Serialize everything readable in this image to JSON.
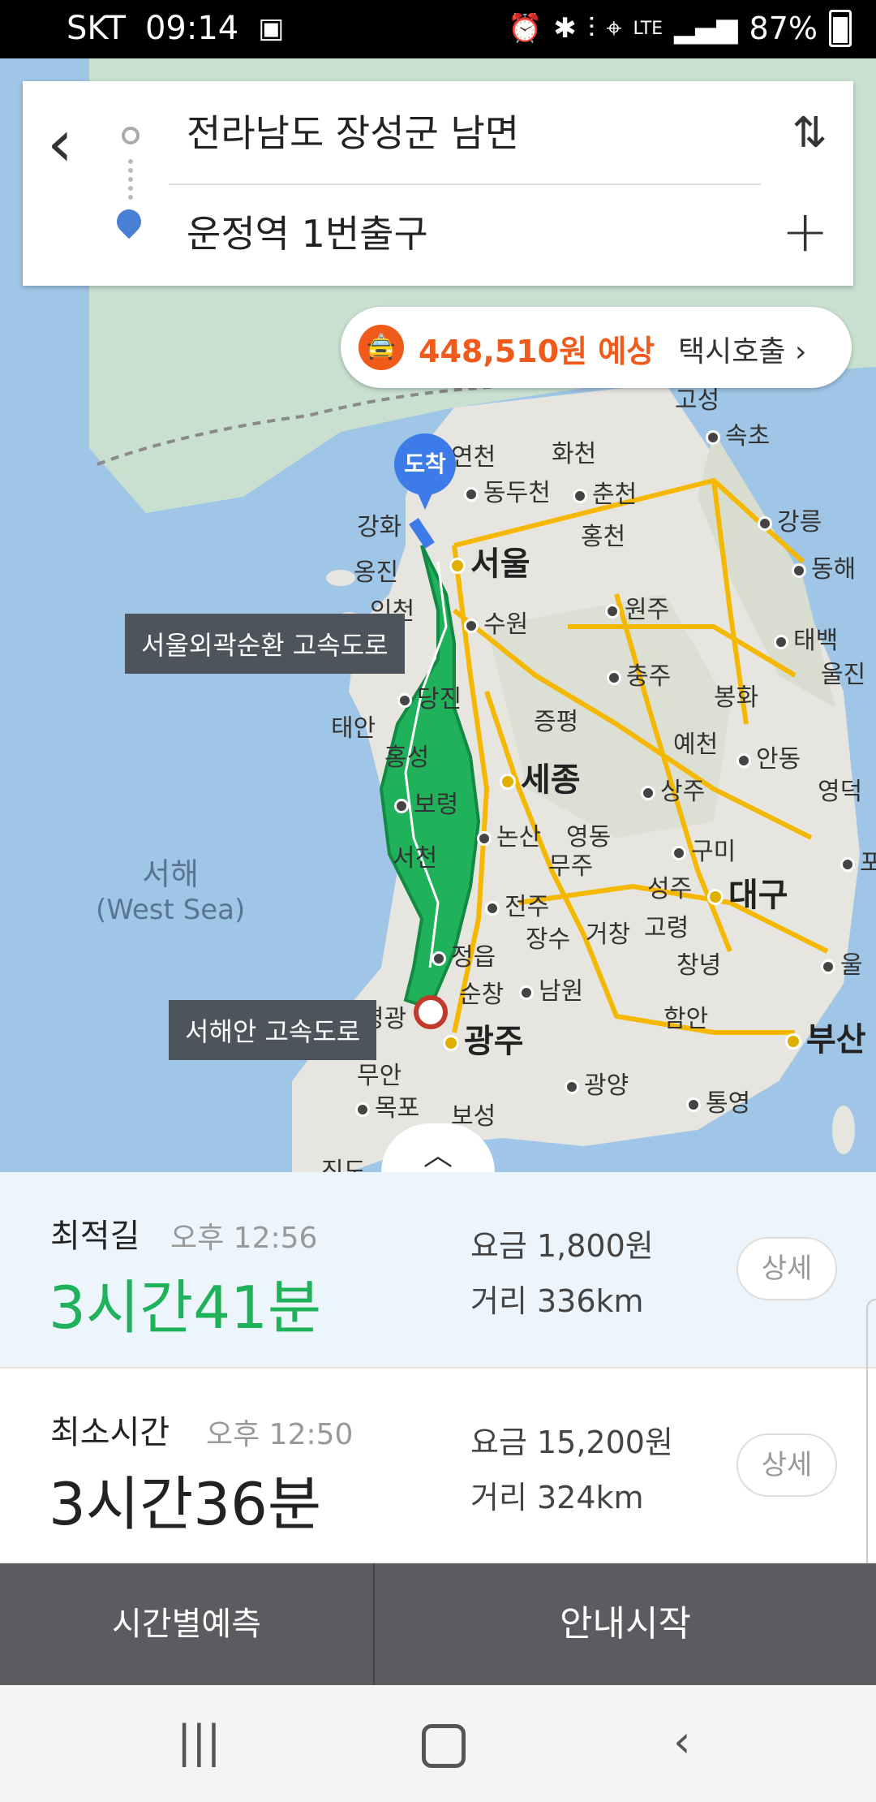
{
  "status_bar": {
    "carrier": "SKT",
    "time": "09:14",
    "network": "LTE",
    "battery": "87%"
  },
  "search": {
    "start": "전라남도 장성군 남면",
    "destination": "운정역 1번출구"
  },
  "taxi": {
    "price": "448,510원 예상",
    "call_label": "택시호출",
    "accent": "#f05a1a"
  },
  "map": {
    "arrival_pin": "도착",
    "road_labels": [
      "서울외곽순환 고속도로",
      "서해안 고속도로"
    ],
    "sea_label": "서해",
    "sea_label_en": "(West Sea)",
    "cities": {
      "goseong": "고성",
      "sokcho": "속초",
      "yeoncheon": "연천",
      "hwacheon": "화천",
      "dongducheon": "동두천",
      "chuncheon": "춘천",
      "ganghwa": "강화",
      "hongcheon": "홍천",
      "gangneung": "강릉",
      "ongjin": "옹진",
      "seoul": "서울",
      "donghae": "동해",
      "incheon": "인천",
      "suwon": "수원",
      "wonju": "원주",
      "taebaek": "태백",
      "uljin": "울진",
      "chungju": "충주",
      "dangjin": "당진",
      "bonghwa": "봉화",
      "taean": "태안",
      "jeungpyeong": "증평",
      "hongseong": "홍성",
      "yecheon": "예천",
      "andong": "안동",
      "sejong": "세종",
      "sangju": "상주",
      "yeongdeok": "영덕",
      "boryeong": "보령",
      "nonsan": "논산",
      "yeongdong": "영동",
      "seocheon": "서천",
      "muju": "무주",
      "gumi": "구미",
      "pohang": "포",
      "seongju": "성주",
      "daegu": "대구",
      "jeonju": "전주",
      "jangsu": "장수",
      "geochang": "거창",
      "goryeong": "고령",
      "jeongeup": "정읍",
      "changnyeong": "창녕",
      "ulsan": "울",
      "sunchang": "순창",
      "namwon": "남원",
      "yeonggwang": "영광",
      "haman": "함안",
      "gwangju": "광주",
      "busan": "부산",
      "muan": "무안",
      "gwangyang": "광양",
      "mokpo": "목포",
      "boseong": "보성",
      "tongyeong": "통영",
      "jindo": "진도"
    }
  },
  "routes": [
    {
      "type": "최적길",
      "arrival": "오후 12:56",
      "duration": "3시간41분",
      "fee": "요금 1,800원",
      "distance": "거리 336km",
      "detail": "상세"
    },
    {
      "type": "최소시간",
      "arrival": "오후 12:50",
      "duration": "3시간36분",
      "fee": "요금 15,200원",
      "distance": "거리 324km",
      "detail": "상세"
    }
  ],
  "actions": {
    "time_forecast": "시간별예측",
    "start_guidance": "안내시작"
  },
  "colors": {
    "route_green": "#1fb25a",
    "route_blue": "#3d7be8",
    "action_bar": "#5a5c60"
  }
}
